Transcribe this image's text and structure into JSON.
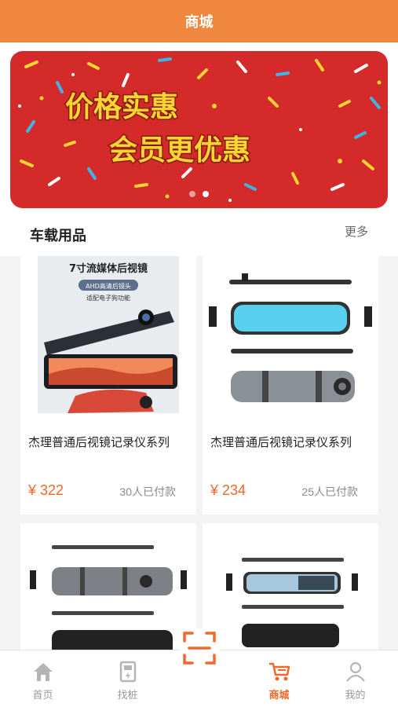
{
  "header": {
    "title": "商城"
  },
  "banner": {
    "line1": "价格实惠",
    "line2": "会员更优惠",
    "dots": 2,
    "active_dot": 1
  },
  "section": {
    "title": "车载用品",
    "more": "更多"
  },
  "products": [
    {
      "promo_title": "7寸流媒体后视镜",
      "promo_sub1": "AHD高清后镜头",
      "promo_sub2": "适配电子狗功能",
      "name": "杰理普通后视镜记录仪系列",
      "price": "¥ 322",
      "sold": "30人已付款"
    },
    {
      "name": "杰理普通后视镜记录仪系列",
      "price": "¥ 234",
      "sold": "25人已付款"
    },
    {
      "name": "",
      "price": "",
      "sold": ""
    },
    {
      "name": "",
      "price": "",
      "sold": ""
    }
  ],
  "tabbar": {
    "items": [
      {
        "label": "首页",
        "icon": "home-icon"
      },
      {
        "label": "找桩",
        "icon": "charging-station-icon"
      },
      {
        "label": "",
        "icon": "scan-icon"
      },
      {
        "label": "商城",
        "icon": "cart-icon"
      },
      {
        "label": "我的",
        "icon": "user-icon"
      }
    ],
    "active": 3
  },
  "colors": {
    "brand": "#f0873f",
    "price": "#f0682b",
    "banner_bg": "#d42a2a"
  }
}
